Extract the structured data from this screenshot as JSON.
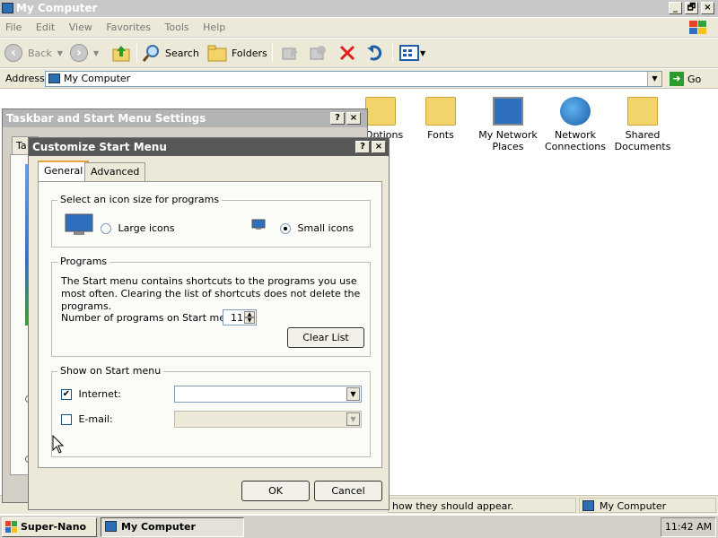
{
  "window": {
    "title": "My Computer",
    "controls": {
      "minimize": "_",
      "maximize": "🗗",
      "close": "×"
    }
  },
  "menu": [
    "File",
    "Edit",
    "View",
    "Favorites",
    "Tools",
    "Help"
  ],
  "toolbar": {
    "back": "Back",
    "search": "Search",
    "folders": "Folders"
  },
  "address": {
    "label": "Address",
    "value": "My Computer",
    "go": "Go"
  },
  "icons": [
    {
      "label": "r Options",
      "icon": "folder-options-icon"
    },
    {
      "label": "Fonts",
      "icon": "fonts-folder-icon"
    },
    {
      "label": "My Network Places",
      "icon": "network-places-icon"
    },
    {
      "label": "Network Connections",
      "icon": "network-connections-icon"
    },
    {
      "label": "Shared Documents",
      "icon": "shared-documents-icon"
    }
  ],
  "status": {
    "text": "how they should appear.",
    "location": "My Computer"
  },
  "taskbar": {
    "start": "Super-Nano XP",
    "task": "My Computer",
    "clock": "11:42 AM"
  },
  "taskbar_dialog": {
    "title": "Taskbar and Start Menu Settings",
    "tab_partial": "Ta",
    "help": "?",
    "close": "×"
  },
  "customize_dialog": {
    "title": "Customize Start Menu",
    "help": "?",
    "close": "×",
    "tabs": [
      "General",
      "Advanced"
    ],
    "icon_size": {
      "caption": "Select an icon size for programs",
      "large": "Large icons",
      "small": "Small icons",
      "selected": "small"
    },
    "programs": {
      "caption": "Programs",
      "description": "The Start menu contains shortcuts to the programs you use most often. Clearing the list of shortcuts does not delete the programs.",
      "count_label": "Number of programs on Start menu:",
      "count_value": "11",
      "clear_button": "Clear List"
    },
    "show": {
      "caption": "Show on Start menu",
      "internet": {
        "label": "Internet:",
        "checked": true,
        "value": ""
      },
      "email": {
        "label": "E-mail:",
        "checked": false,
        "value": ""
      }
    },
    "ok": "OK",
    "cancel": "Cancel"
  }
}
